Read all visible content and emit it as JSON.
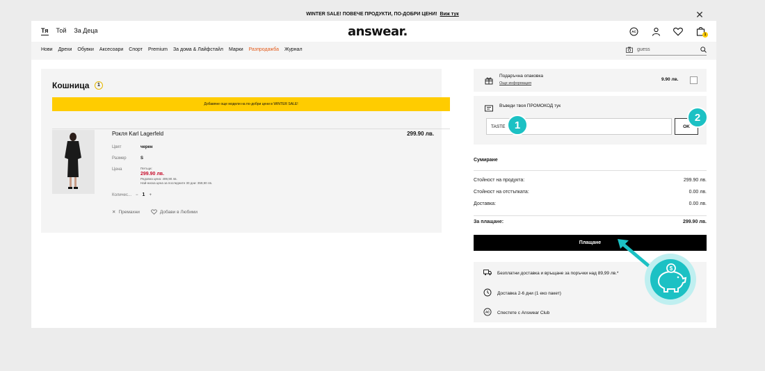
{
  "banner": {
    "text": "WINTER SALE! ПОВЕЧЕ ПРОДУКТИ, ПО-ДОБРИ ЦЕНИ!",
    "link": "Виж тук",
    "close_icon": "close-icon"
  },
  "header": {
    "gender_tabs": [
      "Тя",
      "Той",
      "За Деца"
    ],
    "logo": "answear.",
    "icons": [
      "answear-club-icon",
      "user-icon",
      "heart-icon",
      "bag-icon"
    ],
    "bag_count": "1"
  },
  "nav": {
    "items": [
      "Нови",
      "Дрехи",
      "Обувки",
      "Аксесоари",
      "Спорт",
      "Premium",
      "За дома & Лайфстайл",
      "Марки",
      "Разпродажба",
      "Журнал"
    ],
    "search_value": "guess"
  },
  "cart": {
    "title": "Кошница",
    "count": "1",
    "promo_text": "Добавяне още модели на по-добри цени в WINTER SALE!",
    "product": {
      "name": "Рокля Karl Lagerfeld",
      "price": "299.90 лв.",
      "color_label": "Цвят",
      "color_value": "черен",
      "size_label": "Размер",
      "size_value": "S",
      "price_label": "Цена",
      "price_note": "Петъци:",
      "current_price": "299.90 лв.",
      "regular_price": "Редовна цена: 499,90 лв.",
      "lowest_price": "Най-ниска цена за последните 30 дни: 359,90 лв.",
      "qty_label": "Количес...",
      "qty_minus": "−",
      "qty_value": "1",
      "qty_plus": "+",
      "remove_label": "Премахни",
      "favorite_label": "Добави в Любими"
    }
  },
  "side": {
    "gift_title": "Подаръчна опаковка",
    "gift_more": "Още информация",
    "gift_price": "9.90 лв.",
    "promo_label": "Въведи твоя ПРОМОКОД тук",
    "promo_value": "TASTE",
    "promo_ok": "OK",
    "summary_title": "Сумиране",
    "rows": [
      {
        "label": "Стойност на продукта:",
        "value": "299.90 лв."
      },
      {
        "label": "Стойност на отстъпката:",
        "value": "0.00 лв."
      },
      {
        "label": "Доставка:",
        "value": "0.00 лв."
      }
    ],
    "total_label": "За плащане:",
    "total_value": "299.90 лв.",
    "pay_label": "Плащане",
    "benefits": [
      "Безплатни доставка и връщане за поръчки над 89,99 лв.*",
      "Доставка 2-6 дни (1 еко пакет)",
      "Спестете с Answear Club"
    ]
  },
  "markers": [
    "1",
    "2"
  ],
  "colors": {
    "accent": "#ffcc00",
    "teal": "#1cc1c4",
    "sale": "#e35a1a",
    "price_red": "#c8102e"
  }
}
